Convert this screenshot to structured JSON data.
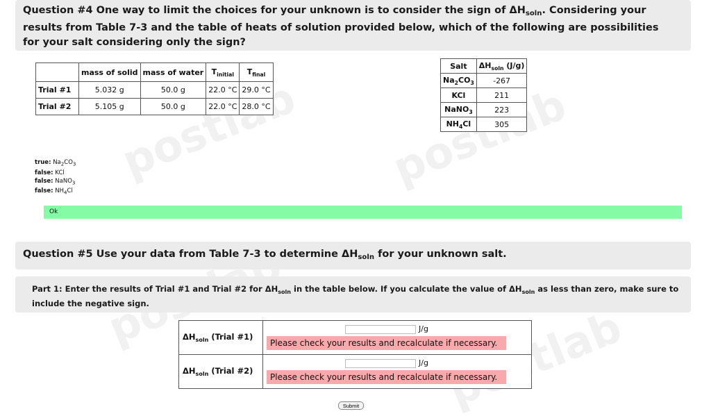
{
  "watermark": "postlab",
  "q4": {
    "text_pre": "Question #4 One way to limit the choices for your unknown is to consider the sign of ΔH",
    "text_sub": "soln",
    "text_post": ". Considering your results from Table 7-3 and the table of heats of solution provided below, which of the following are possibilities for your salt considering only the sign?"
  },
  "trial_table": {
    "headers": [
      "",
      "mass of solid",
      "mass of water",
      "T",
      "initial",
      "T",
      "final"
    ],
    "rows": [
      {
        "label": "Trial #1",
        "mass_solid": "5.032 g",
        "mass_water": "50.0 g",
        "t_initial": "22.0 °C",
        "t_final": "29.0 °C"
      },
      {
        "label": "Trial #2",
        "mass_solid": "5.105 g",
        "mass_water": "50.0 g",
        "t_initial": "22.0 °C",
        "t_final": "28.0 °C"
      }
    ]
  },
  "heat_table": {
    "header_salt": "Salt",
    "header_dh": "ΔH",
    "header_dh_sub": "soln",
    "header_dh_unit": " (J/g)",
    "rows": [
      {
        "salt_main": "Na",
        "salt_sub1": "2",
        "salt_mid": "CO",
        "salt_sub2": "3",
        "value": "-267"
      },
      {
        "salt_main": "KCl",
        "salt_sub1": "",
        "salt_mid": "",
        "salt_sub2": "",
        "value": "211"
      },
      {
        "salt_main": "NaNO",
        "salt_sub1": "3",
        "salt_mid": "",
        "salt_sub2": "",
        "value": "223"
      },
      {
        "salt_main": "NH",
        "salt_sub1": "4",
        "salt_mid": "Cl",
        "salt_sub2": "",
        "value": "305"
      }
    ]
  },
  "results": [
    {
      "verdict": "true:",
      "salt_main": "Na",
      "sub1": "2",
      "mid": "CO",
      "sub2": "3"
    },
    {
      "verdict": "false:",
      "salt_main": "KCl",
      "sub1": "",
      "mid": "",
      "sub2": ""
    },
    {
      "verdict": "false:",
      "salt_main": "NaNO",
      "sub1": "3",
      "mid": "",
      "sub2": ""
    },
    {
      "verdict": "false:",
      "salt_main": "NH",
      "sub1": "4",
      "mid": "Cl",
      "sub2": ""
    }
  ],
  "ok_label": "Ok",
  "q5": {
    "text_pre": "Question #5 Use your data from Table 7-3 to determine ΔH",
    "text_sub": "soln",
    "text_post": " for your unknown salt."
  },
  "part1": {
    "pre": "Part 1: Enter the results of Trial #1 and Trial #2 for ΔH",
    "sub": "soln",
    "mid": " in the table below. If you calculate the value of ΔH",
    "sub2": "soln",
    "post": " as less than zero, make sure to include the negative sign."
  },
  "answers": [
    {
      "label_pre": "ΔH",
      "label_sub": "soln",
      "label_post": " (Trial #1)",
      "value": "",
      "unit": "J/g",
      "error": "Please check your results and recalculate if necessary."
    },
    {
      "label_pre": "ΔH",
      "label_sub": "soln",
      "label_post": " (Trial #2)",
      "value": "",
      "unit": "J/g",
      "error": "Please check your results and recalculate if necessary."
    }
  ],
  "submit_label": "Submit"
}
